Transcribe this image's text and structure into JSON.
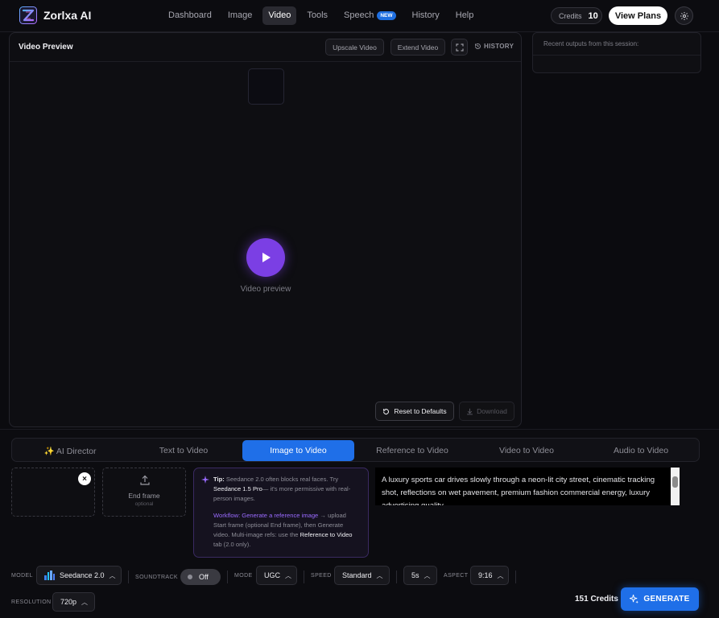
{
  "header": {
    "brand": "Zorlxa AI",
    "nav": [
      "Dashboard",
      "Image",
      "Video",
      "Tools",
      "Speech",
      "History",
      "Help"
    ],
    "nav_active": "Video",
    "speech_badge": "NEW",
    "credits_label": "Credits",
    "credits_value": "10",
    "view_plans": "View Plans",
    "settings_icon": "gear-icon"
  },
  "preview": {
    "title": "Video Preview",
    "upscale": "Upscale Video",
    "extend": "Extend Video",
    "history": "HISTORY",
    "placeholder": "Video preview",
    "reset": "Reset to Defaults",
    "download": "Download"
  },
  "recent": {
    "title": "Recent outputs from this session:"
  },
  "tabs": [
    "✨ AI Director",
    "Text to Video",
    "Image to Video",
    "Reference to Video",
    "Video to Video",
    "Audio to Video"
  ],
  "tabs_active": "Image to Video",
  "frames": {
    "end_label": "End frame",
    "end_sub": "optional",
    "remove": "×"
  },
  "tip": {
    "lead": "Tip:",
    "text1": " Seedance 2.0 often blocks real faces. Try ",
    "model": "Seedance 1.5 Pro",
    "text2": "— it's more permissive with real-person images.",
    "workflow": "Workflow: Generate a reference image",
    "text3": " → upload Start frame (optional End frame), then Generate video. Multi-image refs: use the ",
    "ref_link": "Reference to Video",
    "text4": " tab (2.0 only)."
  },
  "prompt": {
    "text": "A luxury sports car drives slowly through a neon-lit city street, cinematic tracking shot, reflections on wet pavement, premium fashion commercial energy, luxury advertising quality."
  },
  "controls": {
    "model_label": "MODEL",
    "model_value": "Seedance 2.0",
    "soundtrack_label": "SOUNDTRACK",
    "soundtrack_value": "Off",
    "mode_label": "MODE",
    "mode_value": "UGC",
    "speed_label": "SPEED",
    "speed_value": "Standard",
    "duration_value": "5s",
    "aspect_label": "ASPECT",
    "aspect_value": "9:16",
    "resolution_label": "RESOLUTION",
    "resolution_value": "720p"
  },
  "footer": {
    "credits": "151 Credits",
    "generate": "GENERATE"
  },
  "colors": {
    "accent_blue": "#1f6fe8",
    "accent_purple": "#7b3fe4",
    "background": "#0b0b0f"
  }
}
